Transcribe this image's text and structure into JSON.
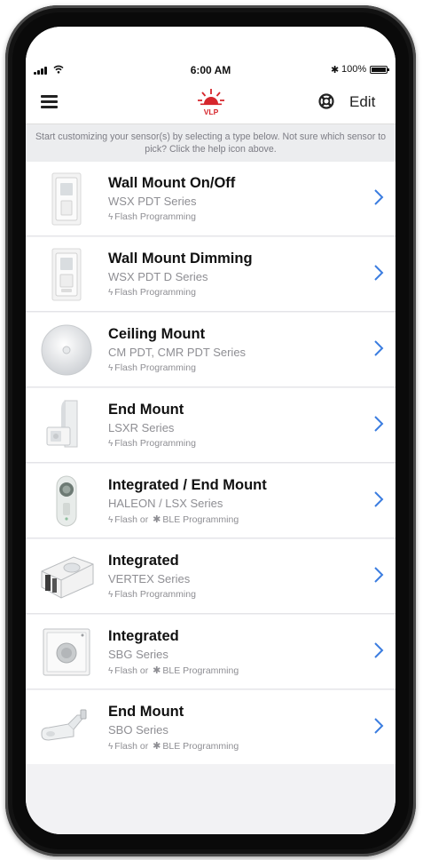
{
  "status_bar": {
    "time": "6:00 AM",
    "battery": "100%"
  },
  "header": {
    "logo_text": "VLP",
    "edit_label": "Edit"
  },
  "banner": {
    "text": "Start customizing your sensor(s) by selecting a type below. Not sure which sensor to pick? Click the help icon above."
  },
  "sensors": [
    {
      "title": "Wall Mount On/Off",
      "series": "WSX PDT Series",
      "programming": "Flash Programming",
      "bluetooth": false
    },
    {
      "title": "Wall Mount Dimming",
      "series": "WSX PDT D Series",
      "programming": "Flash Programming",
      "bluetooth": false
    },
    {
      "title": "Ceiling Mount",
      "series": "CM PDT, CMR PDT Series",
      "programming": "Flash Programming",
      "bluetooth": false
    },
    {
      "title": "End Mount",
      "series": "LSXR Series",
      "programming": "Flash Programming",
      "bluetooth": false
    },
    {
      "title": "Integrated / End Mount",
      "series": "HALEON / LSX Series",
      "programming_prefix": "Flash or",
      "programming": "BLE Programming",
      "bluetooth": true
    },
    {
      "title": "Integrated",
      "series": "VERTEX Series",
      "programming": "Flash Programming",
      "bluetooth": false
    },
    {
      "title": "Integrated",
      "series": "SBG Series",
      "programming_prefix": "Flash or",
      "programming": "BLE Programming",
      "bluetooth": true
    },
    {
      "title": "End Mount",
      "series": "SBO Series",
      "programming_prefix": "Flash or",
      "programming": "BLE Programming",
      "bluetooth": true
    }
  ],
  "colors": {
    "accent_blue": "#3b7de0",
    "logo_red": "#d6262c",
    "secondary_text": "#8e8e93"
  }
}
